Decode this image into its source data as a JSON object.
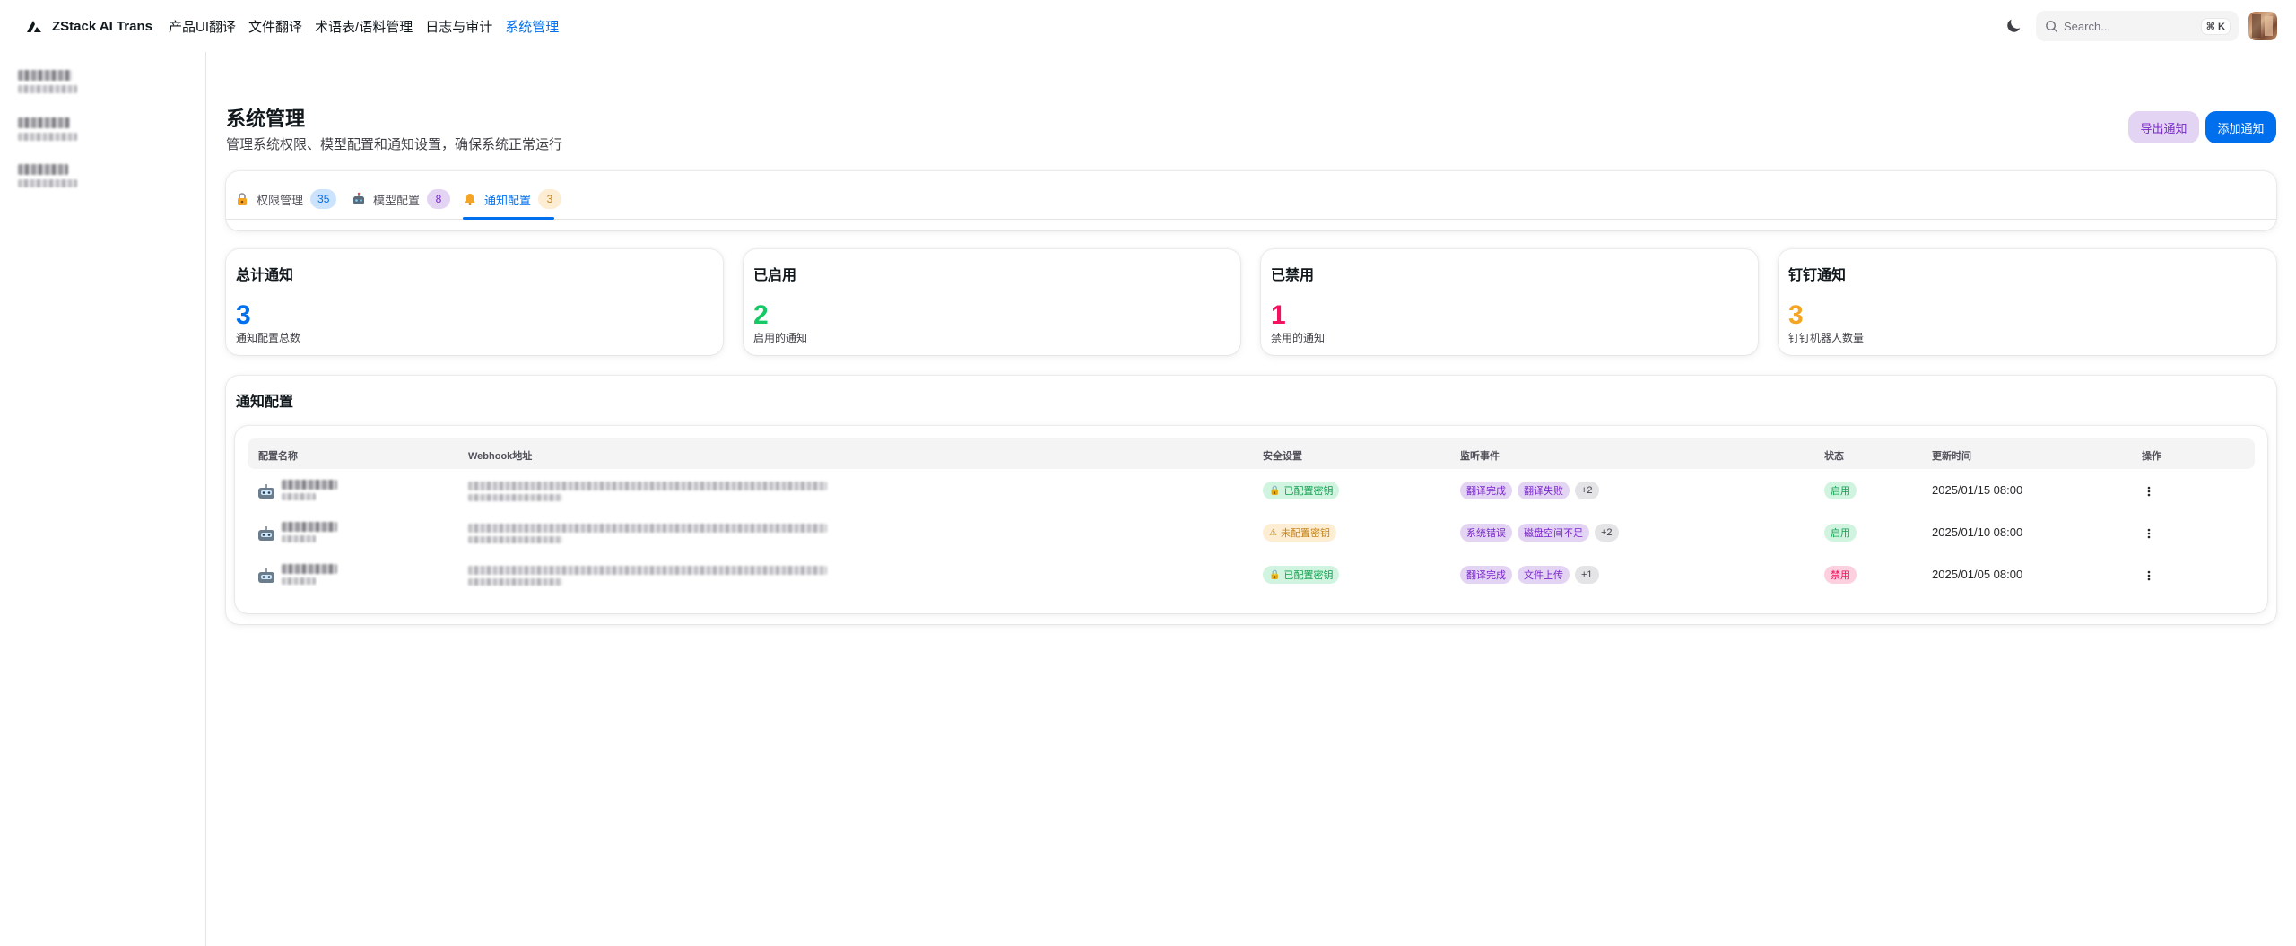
{
  "app": {
    "brand": "ZStack AI Trans",
    "nav": [
      "产品UI翻译",
      "文件翻译",
      "术语表/语料管理",
      "日志与审计",
      "系统管理"
    ],
    "active_nav": "系统管理",
    "search_placeholder": "Search...",
    "search_shortcut": "⌘ K"
  },
  "header": {
    "title": "系统管理",
    "description": "管理系统权限、模型配置和通知设置，确保系统正常运行",
    "export_label": "导出通知",
    "add_label": "添加通知"
  },
  "tabs": [
    {
      "label": "权限管理",
      "count": "35",
      "icon": "lock-key-icon",
      "count_bg": "#cce3fd",
      "count_fg": "#006fee"
    },
    {
      "label": "模型配置",
      "count": "8",
      "icon": "robot-icon",
      "count_bg": "#e4d4f4",
      "count_fg": "#7828c8"
    },
    {
      "label": "通知配置",
      "count": "3",
      "icon": "bell-icon",
      "count_bg": "#fdedd3",
      "count_fg": "#c4841d"
    }
  ],
  "stats": [
    {
      "title": "总计通知",
      "value": "3",
      "label": "通知配置总数",
      "color": "#006fee"
    },
    {
      "title": "已启用",
      "value": "2",
      "label": "启用的通知",
      "color": "#17c964"
    },
    {
      "title": "已禁用",
      "value": "1",
      "label": "禁用的通知",
      "color": "#f31260"
    },
    {
      "title": "钉钉通知",
      "value": "3",
      "label": "钉钉机器人数量",
      "color": "#f5a524"
    }
  ],
  "table": {
    "title": "通知配置",
    "columns": [
      "配置名称",
      "Webhook地址",
      "安全设置",
      "监听事件",
      "状态",
      "更新时间",
      "操作"
    ],
    "rows": [
      {
        "security": "已配置密钥",
        "security_state": "ok",
        "events": [
          "翻译完成",
          "翻译失败"
        ],
        "more": "+2",
        "status": "启用",
        "updated": "2025/01/15 08:00"
      },
      {
        "security": "未配置密钥",
        "security_state": "warn",
        "events": [
          "系统错误",
          "磁盘空间不足"
        ],
        "more": "+2",
        "status": "启用",
        "updated": "2025/01/10 08:00"
      },
      {
        "security": "已配置密钥",
        "security_state": "ok",
        "events": [
          "翻译完成",
          "文件上传"
        ],
        "more": "+1",
        "status": "禁用",
        "updated": "2025/01/05 08:00"
      }
    ]
  }
}
